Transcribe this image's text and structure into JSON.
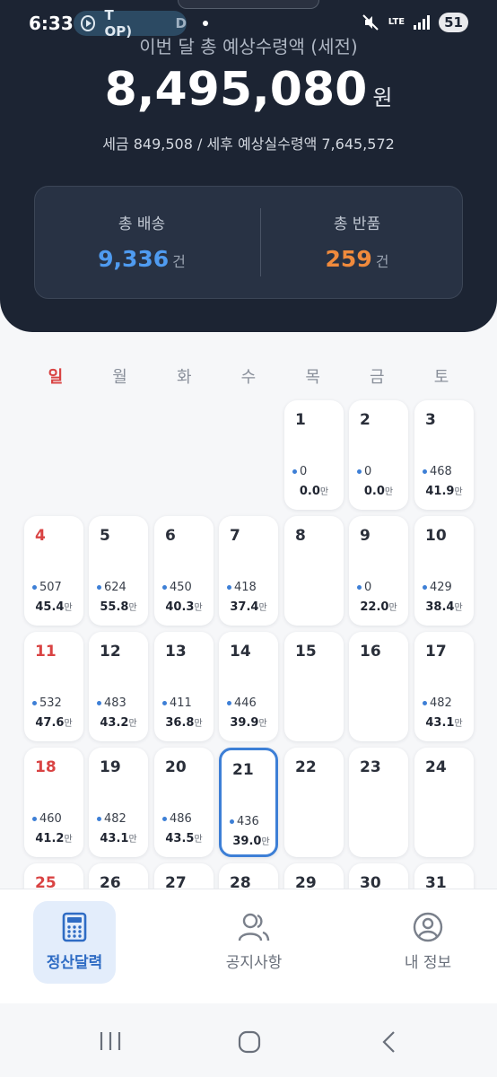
{
  "status_bar": {
    "time": "6:33",
    "pill_text": "T OP)",
    "pill_end": "D",
    "network": "LTE",
    "battery": "51"
  },
  "header": {
    "subtitle": "이번 달 총 예상수령액 (세전)",
    "amount": "8,495,080",
    "amount_unit": "원",
    "tax_line": "세금 849,508 / 세후 예상실수령액 7,645,572",
    "stats": {
      "deliveries_label": "총 배송",
      "deliveries_value": "9,336",
      "deliveries_unit": "건",
      "deliveries_color": "#4f9bf0",
      "returns_label": "총 반품",
      "returns_value": "259",
      "returns_unit": "건",
      "returns_color": "#f08a3c"
    }
  },
  "calendar": {
    "weekdays": [
      "일",
      "월",
      "화",
      "수",
      "목",
      "금",
      "토"
    ],
    "days": [
      {
        "day": "1",
        "count": "0",
        "amount": "0.0",
        "unit": "만"
      },
      {
        "day": "2",
        "count": "0",
        "amount": "0.0",
        "unit": "만"
      },
      {
        "day": "3",
        "count": "468",
        "amount": "41.9",
        "unit": "만"
      },
      {
        "day": "4",
        "count": "507",
        "amount": "45.4",
        "unit": "만"
      },
      {
        "day": "5",
        "count": "624",
        "amount": "55.8",
        "unit": "만"
      },
      {
        "day": "6",
        "count": "450",
        "amount": "40.3",
        "unit": "만"
      },
      {
        "day": "7",
        "count": "418",
        "amount": "37.4",
        "unit": "만"
      },
      {
        "day": "8"
      },
      {
        "day": "9",
        "count": "0",
        "amount": "22.0",
        "unit": "만"
      },
      {
        "day": "10",
        "count": "429",
        "amount": "38.4",
        "unit": "만"
      },
      {
        "day": "11",
        "count": "532",
        "amount": "47.6",
        "unit": "만"
      },
      {
        "day": "12",
        "count": "483",
        "amount": "43.2",
        "unit": "만"
      },
      {
        "day": "13",
        "count": "411",
        "amount": "36.8",
        "unit": "만"
      },
      {
        "day": "14",
        "count": "446",
        "amount": "39.9",
        "unit": "만"
      },
      {
        "day": "15"
      },
      {
        "day": "16"
      },
      {
        "day": "17",
        "count": "482",
        "amount": "43.1",
        "unit": "만"
      },
      {
        "day": "18",
        "count": "460",
        "amount": "41.2",
        "unit": "만"
      },
      {
        "day": "19",
        "count": "482",
        "amount": "43.1",
        "unit": "만"
      },
      {
        "day": "20",
        "count": "486",
        "amount": "43.5",
        "unit": "만"
      },
      {
        "day": "21",
        "count": "436",
        "amount": "39.0",
        "unit": "만",
        "today": true
      },
      {
        "day": "22"
      },
      {
        "day": "23"
      },
      {
        "day": "24"
      },
      {
        "day": "25"
      },
      {
        "day": "26"
      },
      {
        "day": "27"
      },
      {
        "day": "28"
      },
      {
        "day": "29"
      },
      {
        "day": "30"
      },
      {
        "day": "31"
      }
    ],
    "first_weekday": 4
  },
  "bottom_nav": {
    "items": [
      {
        "label": "정산달력",
        "icon": "calculator-icon",
        "active": true
      },
      {
        "label": "공지사항",
        "icon": "people-icon",
        "active": false
      },
      {
        "label": "내 정보",
        "icon": "profile-icon",
        "active": false
      }
    ]
  },
  "colors": {
    "header_bg": "#1c2433",
    "accent": "#3d7fd6",
    "sunday": "#d94343"
  }
}
